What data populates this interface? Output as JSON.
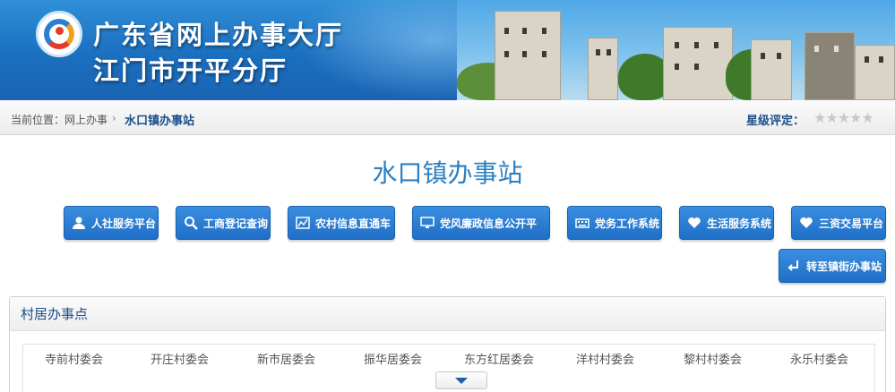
{
  "header": {
    "title_line1": "广东省网上办事大厅",
    "title_line2": "江门市开平分厅"
  },
  "breadcrumb": {
    "prefix": "当前位置：网上办事",
    "separator": "›",
    "current": "水口镇办事站"
  },
  "rating": {
    "label": "星级评定：",
    "stars": "★★★★★",
    "value": 0,
    "max": 5
  },
  "page_title": "水口镇办事站",
  "buttons": [
    {
      "label": "人社服务平台",
      "icon": "user-icon"
    },
    {
      "label": "工商登记查询",
      "icon": "search-icon"
    },
    {
      "label": "农村信息直通车",
      "icon": "chart-icon"
    },
    {
      "label": "党风廉政信息公开平",
      "icon": "monitor-icon"
    },
    {
      "label": "党务工作系统",
      "icon": "keyboard-icon"
    },
    {
      "label": "生活服务系统",
      "icon": "heart-icon"
    },
    {
      "label": "三资交易平台",
      "icon": "heart-icon"
    },
    {
      "label": "转至镇街办事站",
      "icon": "return-icon"
    }
  ],
  "panel": {
    "title": "村居办事点",
    "villages": [
      "寺前村委会",
      "开庄村委会",
      "新市居委会",
      "振华居委会",
      "东方红居委会",
      "洋村村委会",
      "黎村村委会",
      "永乐村委会"
    ]
  },
  "colors": {
    "accent": "#2b7fc1",
    "button": "#1f6fc6",
    "link": "#1a4f8b"
  }
}
